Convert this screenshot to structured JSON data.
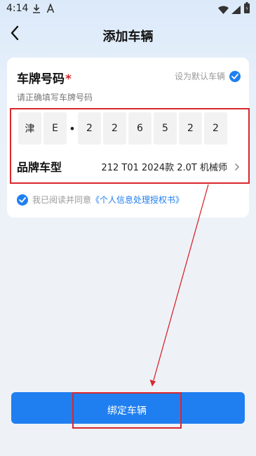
{
  "status_bar": {
    "time": "4:14",
    "icons": [
      "download-icon",
      "font-icon",
      "wifi-icon",
      "signal-icon",
      "battery-icon"
    ]
  },
  "nav": {
    "title": "添加车辆",
    "back_icon": "chevron-left-icon"
  },
  "form": {
    "plate_label": "车牌号码",
    "required_mark": "*",
    "default_label": "设为默认车辆",
    "default_checked": true,
    "hint": "请正确填写车牌号码",
    "plate_chars": [
      "津",
      "E",
      "2",
      "2",
      "6",
      "5",
      "2",
      "2"
    ],
    "plate_separator": "•",
    "brand_label": "品牌车型",
    "brand_value": "212 T01 2024款 2.0T 机械师",
    "agree_checked": true,
    "agree_text": "我已阅读并同意",
    "agree_link": "《个人信息处理授权书》"
  },
  "bind_button": {
    "label": "绑定车辆"
  },
  "colors": {
    "accent": "#1f7ff0",
    "highlight": "#d9272d"
  }
}
